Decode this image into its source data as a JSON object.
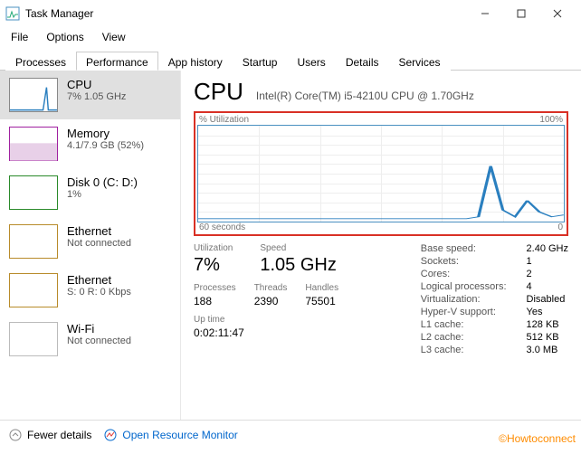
{
  "window": {
    "title": "Task Manager"
  },
  "menu": {
    "file": "File",
    "options": "Options",
    "view": "View"
  },
  "tabs": {
    "processes": "Processes",
    "performance": "Performance",
    "app_history": "App history",
    "startup": "Startup",
    "users": "Users",
    "details": "Details",
    "services": "Services"
  },
  "sidebar": {
    "cpu": {
      "title": "CPU",
      "sub": "7% 1.05 GHz"
    },
    "memory": {
      "title": "Memory",
      "sub": "4.1/7.9 GB (52%)"
    },
    "disk": {
      "title": "Disk 0 (C: D:)",
      "sub": "1%"
    },
    "eth0": {
      "title": "Ethernet",
      "sub": "Not connected"
    },
    "eth1": {
      "title": "Ethernet",
      "sub": "S: 0  R: 0 Kbps"
    },
    "wifi": {
      "title": "Wi-Fi",
      "sub": "Not connected"
    }
  },
  "main": {
    "title": "CPU",
    "model": "Intel(R) Core(TM) i5-4210U CPU @ 1.70GHz",
    "chart_top_left": "% Utilization",
    "chart_top_right": "100%",
    "chart_bot_left": "60 seconds",
    "chart_bot_right": "0",
    "util_label": "Utilization",
    "util_val": "7%",
    "speed_label": "Speed",
    "speed_val": "1.05 GHz",
    "proc_label": "Processes",
    "proc_val": "188",
    "thr_label": "Threads",
    "thr_val": "2390",
    "hnd_label": "Handles",
    "hnd_val": "75501",
    "uptime_label": "Up time",
    "uptime_val": "0:02:11:47",
    "info": {
      "base_k": "Base speed:",
      "base_v": "2.40 GHz",
      "sock_k": "Sockets:",
      "sock_v": "1",
      "core_k": "Cores:",
      "core_v": "2",
      "lp_k": "Logical processors:",
      "lp_v": "4",
      "virt_k": "Virtualization:",
      "virt_v": "Disabled",
      "hv_k": "Hyper-V support:",
      "hv_v": "Yes",
      "l1_k": "L1 cache:",
      "l1_v": "128 KB",
      "l2_k": "L2 cache:",
      "l2_v": "512 KB",
      "l3_k": "L3 cache:",
      "l3_v": "3.0 MB"
    }
  },
  "footer": {
    "fewer": "Fewer details",
    "resmon": "Open Resource Monitor"
  },
  "watermark": "©Howtoconnect",
  "chart_data": {
    "type": "line",
    "title": "% Utilization",
    "xlabel": "seconds",
    "ylabel": "% Utilization",
    "xlim": [
      0,
      60
    ],
    "ylim": [
      0,
      100
    ],
    "x": [
      0,
      2,
      4,
      6,
      8,
      10,
      12,
      14,
      16,
      18,
      20,
      22,
      24,
      26,
      28,
      30,
      32,
      34,
      36,
      38,
      40,
      42,
      44,
      46,
      48,
      50,
      52,
      54,
      56,
      58,
      60
    ],
    "values": [
      3,
      3,
      3,
      3,
      3,
      3,
      3,
      3,
      3,
      3,
      3,
      3,
      3,
      3,
      3,
      3,
      3,
      3,
      3,
      3,
      3,
      3,
      3,
      5,
      58,
      12,
      5,
      22,
      10,
      5,
      7
    ]
  }
}
